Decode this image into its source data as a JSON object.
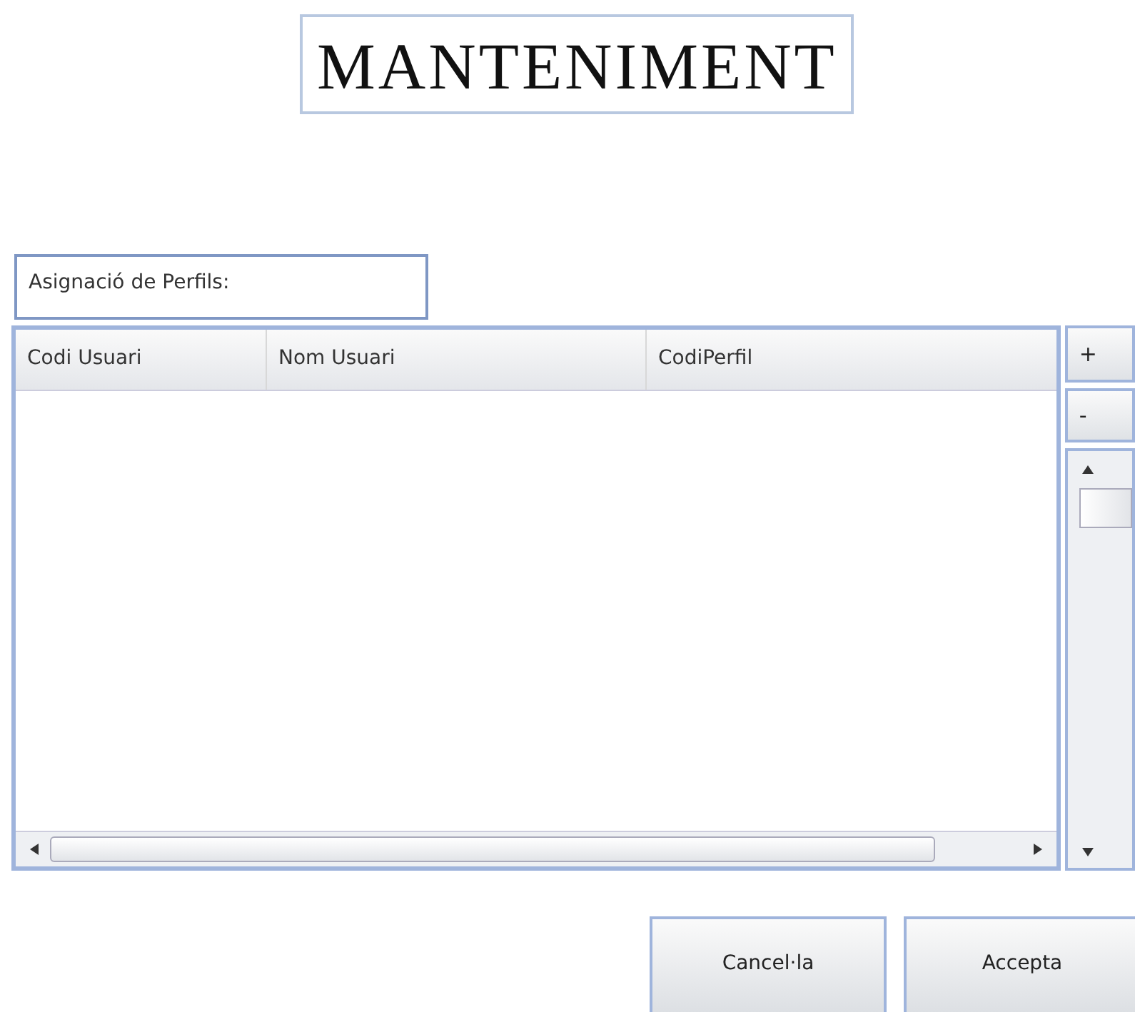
{
  "title": "MANTENIMENT",
  "section_label": "Asignació de Perfils:",
  "table": {
    "columns": [
      "Codi Usuari",
      "Nom Usuari",
      "CodiPerfil"
    ]
  },
  "side_buttons": [
    "+",
    "-"
  ],
  "buttons": [
    "Cancel·la",
    "Accepta"
  ]
}
